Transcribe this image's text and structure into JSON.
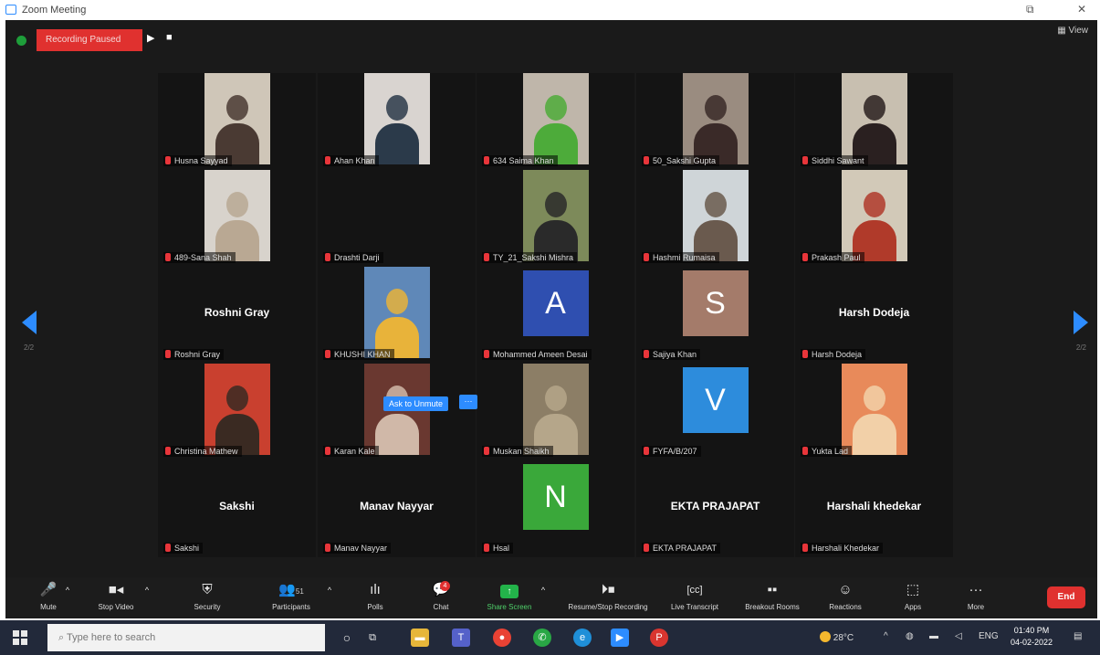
{
  "window": {
    "title": "Zoom Meeting",
    "restore_glyph": "⧉",
    "close_glyph": "✕"
  },
  "topbar": {
    "recording_status": "Recording Paused",
    "resume_icon": "play-icon",
    "stop_icon": "stop-icon",
    "view_label": "View",
    "colors": {
      "recording": "#e0312f",
      "secure": "#1e9e3a"
    }
  },
  "gallery": {
    "page_indicator_left": "2/2",
    "page_indicator_right": "2/2",
    "ask_to_unmute_label": "Ask to Unmute",
    "more_label": "···",
    "tiles": [
      {
        "name": "Husna Sayyad",
        "kind": "video",
        "bg": "#cfc6b8",
        "fg": "#4a3a33"
      },
      {
        "name": "Ahan Khan",
        "kind": "video",
        "bg": "#d9d4d0",
        "fg": "#2b3a4a"
      },
      {
        "name": "634 Saima Khan",
        "kind": "video",
        "bg": "#bfb6aa",
        "fg": "#4dab3a"
      },
      {
        "name": "50_Sakshi Gupta",
        "kind": "video",
        "bg": "#9a8c80",
        "fg": "#3a2a28"
      },
      {
        "name": "Siddhi Sawant",
        "kind": "video",
        "bg": "#c8bfb0",
        "fg": "#2a2020"
      },
      {
        "name": "489-Sana Shah",
        "kind": "video",
        "bg": "#d8d3cc",
        "fg": "#b9a893"
      },
      {
        "name": "Drashti Darji",
        "kind": "empty"
      },
      {
        "name": "TY_21_Sakshi Mishra",
        "kind": "video",
        "bg": "#7d8a5a",
        "fg": "#2a2a2a"
      },
      {
        "name": "Hashmi Rumaisa",
        "kind": "video",
        "bg": "#cfd5d8",
        "fg": "#6a5a4e"
      },
      {
        "name": "Prakash Paul",
        "kind": "video",
        "bg": "#d2c9b8",
        "fg": "#b03a2a"
      },
      {
        "name": "Roshni Gray",
        "kind": "name",
        "display": "Roshni Gray"
      },
      {
        "name": "KHUSHI KHAN",
        "kind": "video",
        "bg": "#5f88b8",
        "fg": "#e8b33a"
      },
      {
        "name": "Mohammed Ameen  Desai",
        "kind": "avatar",
        "letter": "A",
        "color": "#2f4fb0"
      },
      {
        "name": "Sajiya Khan",
        "kind": "avatar",
        "letter": "S",
        "color": "#a47b6a"
      },
      {
        "name": "Harsh Dodeja",
        "kind": "name",
        "display": "Harsh Dodeja"
      },
      {
        "name": "Christina Mathew",
        "kind": "video",
        "bg": "#c9402f",
        "fg": "#3a2a22"
      },
      {
        "name": "Karan Kale",
        "kind": "video",
        "bg": "#6a3830",
        "fg": "#d0b8a8"
      },
      {
        "name": "Muskan Shaikh",
        "kind": "video",
        "bg": "#8c7e66",
        "fg": "#b5a68a"
      },
      {
        "name": "FYFA/B/207",
        "kind": "avatar",
        "letter": "V",
        "color": "#2d8cdc"
      },
      {
        "name": "Yukta Lad",
        "kind": "video",
        "bg": "#e88a5a",
        "fg": "#f2d0a8"
      },
      {
        "name": "Sakshi",
        "kind": "name",
        "display": "Sakshi"
      },
      {
        "name": "Manav Nayyar",
        "kind": "name",
        "display": "Manav Nayyar"
      },
      {
        "name": "Hsal",
        "kind": "avatar",
        "letter": "N",
        "color": "#3aa83a"
      },
      {
        "name": "EKTA PRAJAPAT",
        "kind": "name",
        "display": "EKTA PRAJAPAT"
      },
      {
        "name": "Harshali Khedekar",
        "kind": "name",
        "display": "Harshali khedekar"
      }
    ]
  },
  "toolbar": {
    "mute": "Mute",
    "stop_video": "Stop Video",
    "security": "Security",
    "participants": "Participants",
    "participants_count": "51",
    "polls": "Polls",
    "chat": "Chat",
    "chat_badge": "4",
    "share_screen": "Share Screen",
    "resume_stop_recording": "Resume/Stop Recording",
    "live_transcript": "Live Transcript",
    "breakout_rooms": "Breakout Rooms",
    "reactions": "Reactions",
    "apps": "Apps",
    "more": "More",
    "end": "End",
    "colors": {
      "share": "#23b34a",
      "end": "#e0312f"
    }
  },
  "taskbar": {
    "search_placeholder": "Type here to search",
    "weather": "28°C",
    "language": "ENG",
    "time": "01:40 PM",
    "date": "04-02-2022"
  }
}
